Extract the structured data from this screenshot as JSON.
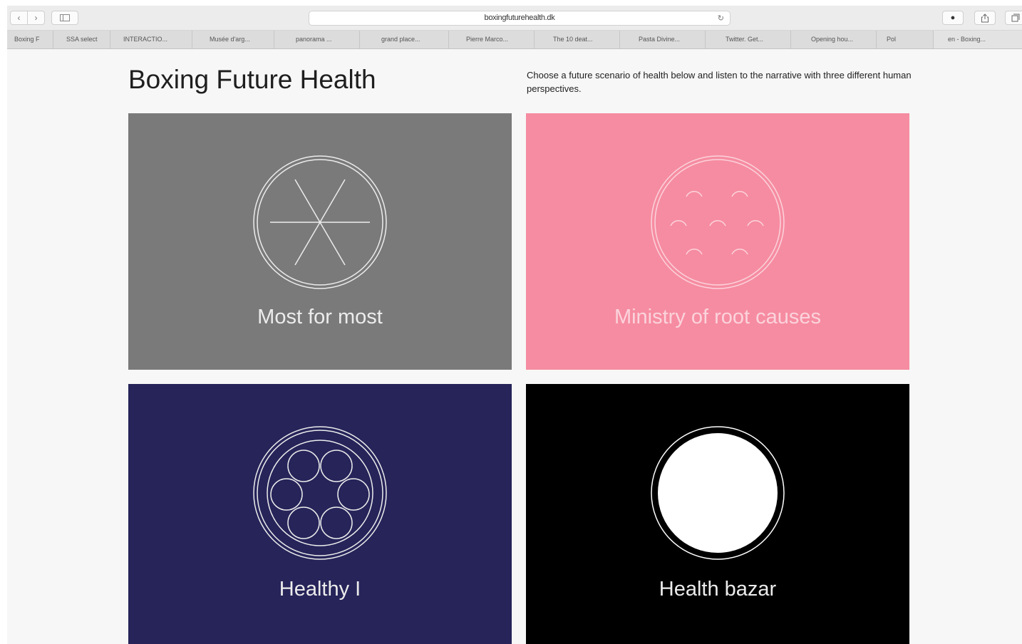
{
  "browser": {
    "url": "boxingfuturehealth.dk",
    "bookmarks": [
      "Boxing F",
      "SSA select",
      "INTERACTIO...",
      "Musée d'arg...",
      "panorama ...",
      "grand place...",
      "Pierre Marco...",
      "The 10 deat...",
      "Pasta Divine...",
      "Twitter. Get...",
      "Opening hou...",
      "Pol",
      "en - Boxing..."
    ]
  },
  "page": {
    "title": "Boxing Future Health",
    "intro": "Choose a future scenario of health below and listen to the narrative with three different human perspectives."
  },
  "scenarios": [
    {
      "label": "Most for most",
      "color": "#7a7a7a",
      "icon": "spokes-circle-icon"
    },
    {
      "label": "Ministry of root causes",
      "color": "#f68ca1",
      "icon": "arcs-circle-icon"
    },
    {
      "label": "Healthy I",
      "color": "#262459",
      "icon": "ring-of-circles-icon"
    },
    {
      "label": "Health bazar",
      "color": "#000000",
      "icon": "filled-circle-icon"
    }
  ]
}
